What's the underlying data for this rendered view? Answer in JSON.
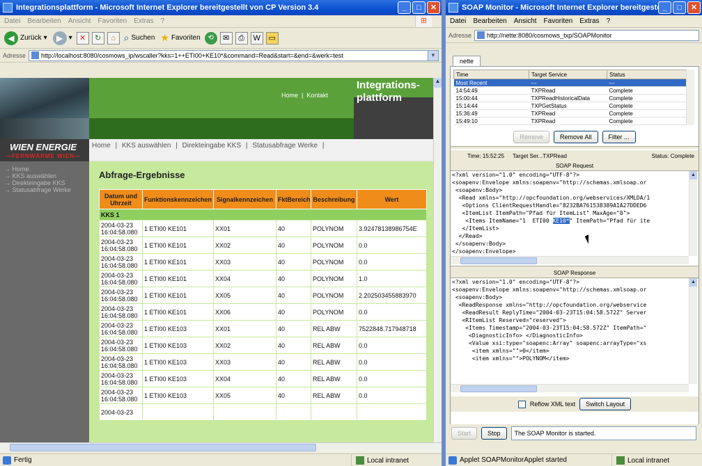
{
  "left_window": {
    "title": "Integrationsplattform - Microsoft Internet Explorer bereitgestellt von CP  Version  3.4",
    "menu": [
      "Datei",
      "Bearbeiten",
      "Ansicht",
      "Favoriten",
      "Extras",
      "?"
    ],
    "toolbar": {
      "back": "Zurück",
      "search": "Suchen",
      "favorites": "Favoriten"
    },
    "address_label": "Adresse",
    "address_url": "http://localhost:8080/cosmows_ip/wscaller?kks=1++ETI00+KE10*&command=Read&start=&end=&werk=test",
    "status": "Fertig",
    "zone": "Local intranet"
  },
  "site": {
    "brand_line1": "Integrations-",
    "brand_line2": "plattform",
    "topnav": [
      "Home",
      "Kontakt"
    ],
    "logo_main": "WIEN ENERGIE",
    "logo_sub": "—FERNWÄRME WIEN—",
    "leftnav": [
      "→ Home",
      "→ KKS auswählen",
      "→ Direkteingabe KKS",
      "→ Statusabfrage Werke"
    ],
    "breadcrumb": [
      "Home",
      "|",
      "KKS auswählen",
      "|",
      "Direkteingabe KKS",
      "|",
      "Statusabfrage Werke",
      "|"
    ],
    "heading": "Abfrage-Ergebnisse"
  },
  "results": {
    "columns": [
      "Datum und Uhrzeit",
      "Funktionskennzeichen",
      "Signalkennzeichen",
      "FktBereich",
      "Beschreibung",
      "Wert"
    ],
    "group": "KKS 1",
    "rows": [
      {
        "date": "2004-03-23",
        "time": "16:04:58.080",
        "fkz": "1 ETI00 KE101",
        "skz": "XX01",
        "fb": "40",
        "desc": "POLYNOM",
        "val": "3.92478138986754E"
      },
      {
        "date": "2004-03-23",
        "time": "16:04:58.080",
        "fkz": "1 ETI00 KE101",
        "skz": "XX02",
        "fb": "40",
        "desc": "POLYNOM",
        "val": "0.0"
      },
      {
        "date": "2004-03-23",
        "time": "16:04:58.080",
        "fkz": "1 ETI00 KE101",
        "skz": "XX03",
        "fb": "40",
        "desc": "POLYNOM",
        "val": "0.0"
      },
      {
        "date": "2004-03-23",
        "time": "16:04:58.080",
        "fkz": "1 ETI00 KE101",
        "skz": "XX04",
        "fb": "40",
        "desc": "POLYNOM",
        "val": "1.0"
      },
      {
        "date": "2004-03-23",
        "time": "16:04:58.080",
        "fkz": "1 ETI00 KE101",
        "skz": "XX05",
        "fb": "40",
        "desc": "POLYNOM",
        "val": "2.202503455883970"
      },
      {
        "date": "2004-03-23",
        "time": "16:04:58.080",
        "fkz": "1 ETI00 KE101",
        "skz": "XX06",
        "fb": "40",
        "desc": "POLYNOM",
        "val": "0.0"
      },
      {
        "date": "2004-03-23",
        "time": "16:04:58.080",
        "fkz": "1 ETI00 KE103",
        "skz": "XX01",
        "fb": "40",
        "desc": "REL ABW",
        "val": "7522848.717948718"
      },
      {
        "date": "2004-03-23",
        "time": "16:04:58.080",
        "fkz": "1 ETI00 KE103",
        "skz": "XX02",
        "fb": "40",
        "desc": "REL ABW",
        "val": "0.0"
      },
      {
        "date": "2004-03-23",
        "time": "16:04:58.080",
        "fkz": "1 ETI00 KE103",
        "skz": "XX03",
        "fb": "40",
        "desc": "REL ABW",
        "val": "0.0"
      },
      {
        "date": "2004-03-23",
        "time": "16:04:58.080",
        "fkz": "1 ETI00 KE103",
        "skz": "XX04",
        "fb": "40",
        "desc": "REL ABW",
        "val": "0.0"
      },
      {
        "date": "2004-03-23",
        "time": "16:04:58.080",
        "fkz": "1 ETI00 KE103",
        "skz": "XX05",
        "fb": "40",
        "desc": "REL ABW",
        "val": "0.0"
      },
      {
        "date": "2004-03-23",
        "time": "",
        "fkz": "",
        "skz": "",
        "fb": "",
        "desc": "",
        "val": ""
      }
    ]
  },
  "right_window": {
    "title": "SOAP Monitor - Microsoft Internet Explorer bereitgestellt vo...",
    "menu": [
      "Datei",
      "Bearbeiten",
      "Ansicht",
      "Favoriten",
      "Extras",
      "?"
    ],
    "address_label": "Adresse",
    "address_url": "http://nette:8080/cosmows_txp/SOAPMonitor",
    "status": "Applet SOAPMonitorApplet started",
    "zone": "Local intranet"
  },
  "soap": {
    "tab": "nette",
    "history_columns": [
      "Time",
      "Target Service",
      "Status"
    ],
    "history": [
      {
        "time": "Most Recent",
        "service": "---",
        "status": "---"
      },
      {
        "time": "14:54:49",
        "service": "TXPRead",
        "status": "Complete"
      },
      {
        "time": "15:00:44",
        "service": "TXPReadHistoricalData",
        "status": "Complete"
      },
      {
        "time": "15:14:44",
        "service": "TXPGetStatus",
        "status": "Complete"
      },
      {
        "time": "15:36:49",
        "service": "TXPRead",
        "status": "Complete"
      },
      {
        "time": "15:49:10",
        "service": "TXPRead",
        "status": "Complete"
      }
    ],
    "btn_remove": "Remove",
    "btn_remove_all": "Remove All",
    "btn_filter": "Filter ...",
    "info_time": "Time: 15:52:25",
    "info_target": "Target Ser...TXPRead",
    "info_status": "Status: Complete",
    "request_label": "SOAP Request",
    "request_lines": [
      "<?xml version=\"1.0\" encoding=\"UTF-8\"?>",
      "<soapenv:Envelope xmlns:soapenv=\"http://schemas.xmlsoap.or",
      " <soapenv:Body>",
      "  <Read xmlns=\"http://opcfoundation.org/webservices/XMLDA/1",
      "   <Options ClientRequestHandle=\"8232BA761538389A1A27DDED6",
      "   <ItemList ItemPath=\"Pfad für ItemList\" MaxAge=\"0\">",
      "    <Items ItemName=\"1  ETI00 |KE10*|\" ItemPath=\"Pfad für ite",
      "   </ItemList>",
      "  </Read>",
      " </soapenv:Body>",
      "</soapenv:Envelope>"
    ],
    "response_label": "SOAP Response",
    "response_lines": [
      "<?xml version=\"1.0\" encoding=\"UTF-8\"?>",
      "<soapenv:Envelope xmlns:soapenv=\"http://schemas.xmlsoap.or",
      " <soapenv:Body>",
      "  <ReadResponse xmlns=\"http://opcfoundation.org/webservice",
      "   <ReadResult ReplyTime=\"2004-03-23T15:04:58.572Z\" Server",
      "   <RItemList Reserved=\"reserved\">",
      "    <Items Timestamp=\"2004-03-23T15:04:58.572Z\" ItemPath=\"",
      "     <DiagnosticInfo> </DiagnosticInfo>",
      "     <Value xsi:type=\"soapenc:Array\" soapenc:arrayType=\"xs",
      "      <item xmlns=\"\">0</item>",
      "      <item xmlns=\"\">POLYNOM</item>"
    ],
    "reflow_label": "Reflow XML text",
    "btn_switch": "Switch Layout",
    "btn_start": "Start",
    "btn_stop": "Stop",
    "message": "The SOAP Monitor is started."
  }
}
